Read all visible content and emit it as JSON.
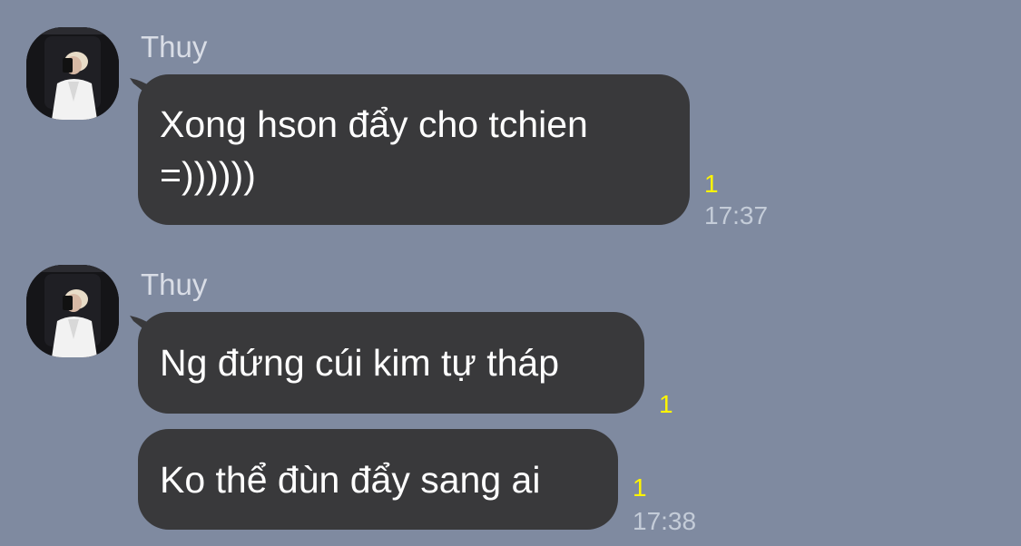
{
  "colors": {
    "background": "#7f8aa0",
    "bubble": "#39393b",
    "read_count": "#fff500",
    "time_text": "#c4ccd8",
    "sender_text": "#d9dde6"
  },
  "groups": [
    {
      "sender": "Thuy",
      "avatar_icon": "profile-photo",
      "messages": [
        {
          "text": "Xong hson đẩy cho tchien\n=))))))",
          "read_count": "1",
          "time": "17:37"
        }
      ]
    },
    {
      "sender": "Thuy",
      "avatar_icon": "profile-photo",
      "messages": [
        {
          "text": "Ng đứng cúi kim tự tháp",
          "read_count": "1"
        },
        {
          "text": "Ko thể đùn đẩy sang ai",
          "read_count": "1",
          "time": "17:38"
        }
      ]
    }
  ]
}
